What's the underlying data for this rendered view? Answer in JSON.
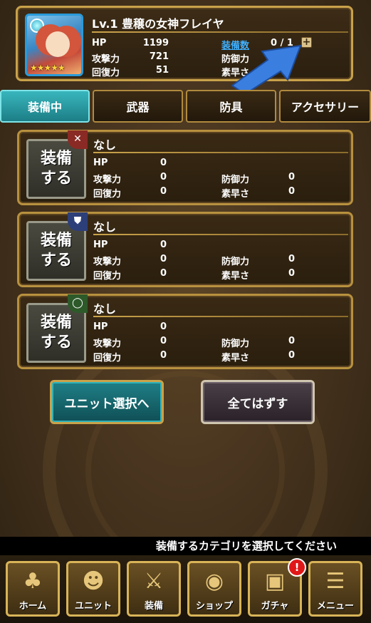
{
  "unit": {
    "name": "Lv.1 豊穣の女神フレイヤ",
    "stars": "★★★★★",
    "stats": {
      "hp_label": "HP",
      "hp_value": "1199",
      "atk_label": "攻撃力",
      "atk_value": "721",
      "rec_label": "回復力",
      "rec_value": "51",
      "equip_count_label": "装備数",
      "equip_count_value": "0 / 1",
      "def_label": "防御力",
      "spd_label": "素早さ"
    }
  },
  "tabs": [
    {
      "label": "装備中",
      "active": true
    },
    {
      "label": "武器",
      "active": false
    },
    {
      "label": "防具",
      "active": false
    },
    {
      "label": "アクセサリー",
      "active": false
    }
  ],
  "slots": [
    {
      "badge_icon": "crossed-swords-icon",
      "badge_color": "#8a2a24",
      "equip_label_1": "装備",
      "equip_label_2": "する",
      "name": "なし",
      "hp_label": "HP",
      "hp": "0",
      "atk_label": "攻撃力",
      "atk": "0",
      "rec_label": "回復力",
      "rec": "0",
      "def_label": "防御力",
      "def": "0",
      "spd_label": "素早さ",
      "spd": "0"
    },
    {
      "badge_icon": "shield-icon",
      "badge_color": "#2d3f78",
      "equip_label_1": "装備",
      "equip_label_2": "する",
      "name": "なし",
      "hp_label": "HP",
      "hp": "0",
      "atk_label": "攻撃力",
      "atk": "0",
      "rec_label": "回復力",
      "rec": "0",
      "def_label": "防御力",
      "def": "0",
      "spd_label": "素早さ",
      "spd": "0"
    },
    {
      "badge_icon": "ring-icon",
      "badge_color": "#2e5a2a",
      "equip_label_1": "装備",
      "equip_label_2": "する",
      "name": "なし",
      "hp_label": "HP",
      "hp": "0",
      "atk_label": "攻撃力",
      "atk": "0",
      "rec_label": "回復力",
      "rec": "0",
      "def_label": "防御力",
      "def": "0",
      "spd_label": "素早さ",
      "spd": "0"
    }
  ],
  "buttons": {
    "unit_select": "ユニット選択へ",
    "remove_all": "全てはずす"
  },
  "status_message": "装備するカテゴリを選択してください",
  "nav": [
    {
      "label": "ホーム",
      "icon": "tree-icon"
    },
    {
      "label": "ユニット",
      "icon": "unit-portrait-icon"
    },
    {
      "label": "装備",
      "icon": "crossed-swords-icon"
    },
    {
      "label": "ショップ",
      "icon": "coin-icon"
    },
    {
      "label": "ガチャ",
      "icon": "cards-icon"
    },
    {
      "label": "メニュー",
      "icon": "menu-icon"
    }
  ],
  "nav_badge": "!"
}
